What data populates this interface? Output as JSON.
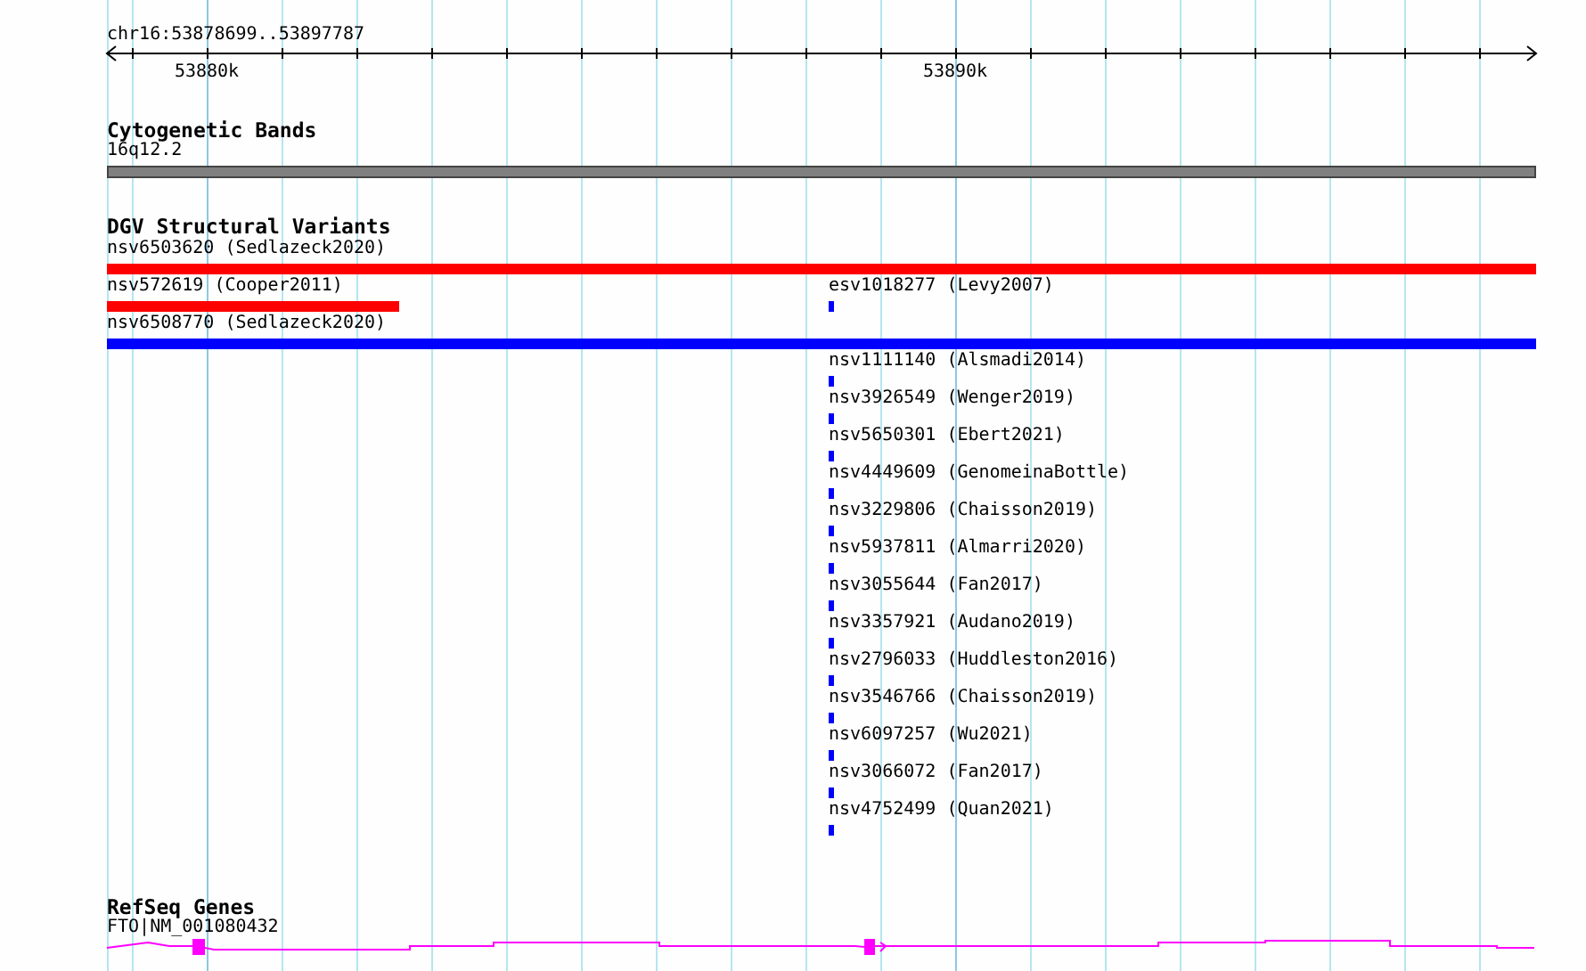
{
  "ruler": {
    "location": "chr16:53878699..53897787",
    "ticks": [
      "53880k",
      "53890k"
    ]
  },
  "cytogenetic_bands": {
    "title": "Cytogenetic Bands",
    "band": {
      "label": "16q12.2"
    }
  },
  "dgv_structural_variants": {
    "title": "DGV Structural Variants",
    "rows": [
      [
        {
          "label": "nsv6503620 (Sedlazeck2020)",
          "kind": "full",
          "color": "#ff0000"
        }
      ],
      [
        {
          "label": "nsv572619 (Cooper2011)",
          "kind": "left",
          "color": "#ff0000"
        },
        {
          "label": "esv1018277 (Levy2007)",
          "kind": "point",
          "color": "#0000ff"
        }
      ],
      [
        {
          "label": "nsv6508770 (Sedlazeck2020)",
          "kind": "full",
          "color": "#0000ff"
        }
      ],
      [
        {
          "label": "nsv1111140 (Alsmadi2014)",
          "kind": "point",
          "color": "#0000ff"
        }
      ],
      [
        {
          "label": "nsv3926549 (Wenger2019)",
          "kind": "point",
          "color": "#0000ff"
        }
      ],
      [
        {
          "label": "nsv5650301 (Ebert2021)",
          "kind": "point",
          "color": "#0000ff"
        }
      ],
      [
        {
          "label": "nsv4449609 (GenomeinaBottle)",
          "kind": "point",
          "color": "#0000ff"
        }
      ],
      [
        {
          "label": "nsv3229806 (Chaisson2019)",
          "kind": "point",
          "color": "#0000ff"
        }
      ],
      [
        {
          "label": "nsv5937811 (Almarri2020)",
          "kind": "point",
          "color": "#0000ff"
        }
      ],
      [
        {
          "label": "nsv3055644 (Fan2017)",
          "kind": "point",
          "color": "#0000ff"
        }
      ],
      [
        {
          "label": "nsv3357921 (Audano2019)",
          "kind": "point",
          "color": "#0000ff"
        }
      ],
      [
        {
          "label": "nsv2796033 (Huddleston2016)",
          "kind": "point",
          "color": "#0000ff"
        }
      ],
      [
        {
          "label": "nsv3546766 (Chaisson2019)",
          "kind": "point",
          "color": "#0000ff"
        }
      ],
      [
        {
          "label": "nsv6097257 (Wu2021)",
          "kind": "point",
          "color": "#0000ff"
        }
      ],
      [
        {
          "label": "nsv3066072 (Fan2017)",
          "kind": "point",
          "color": "#0000ff"
        }
      ],
      [
        {
          "label": "nsv4752499 (Quan2021)",
          "kind": "point",
          "color": "#0000ff"
        }
      ]
    ]
  },
  "refseq_genes": {
    "title": "RefSeq Genes",
    "gene": {
      "label": "FTO|NM_001080432"
    }
  }
}
